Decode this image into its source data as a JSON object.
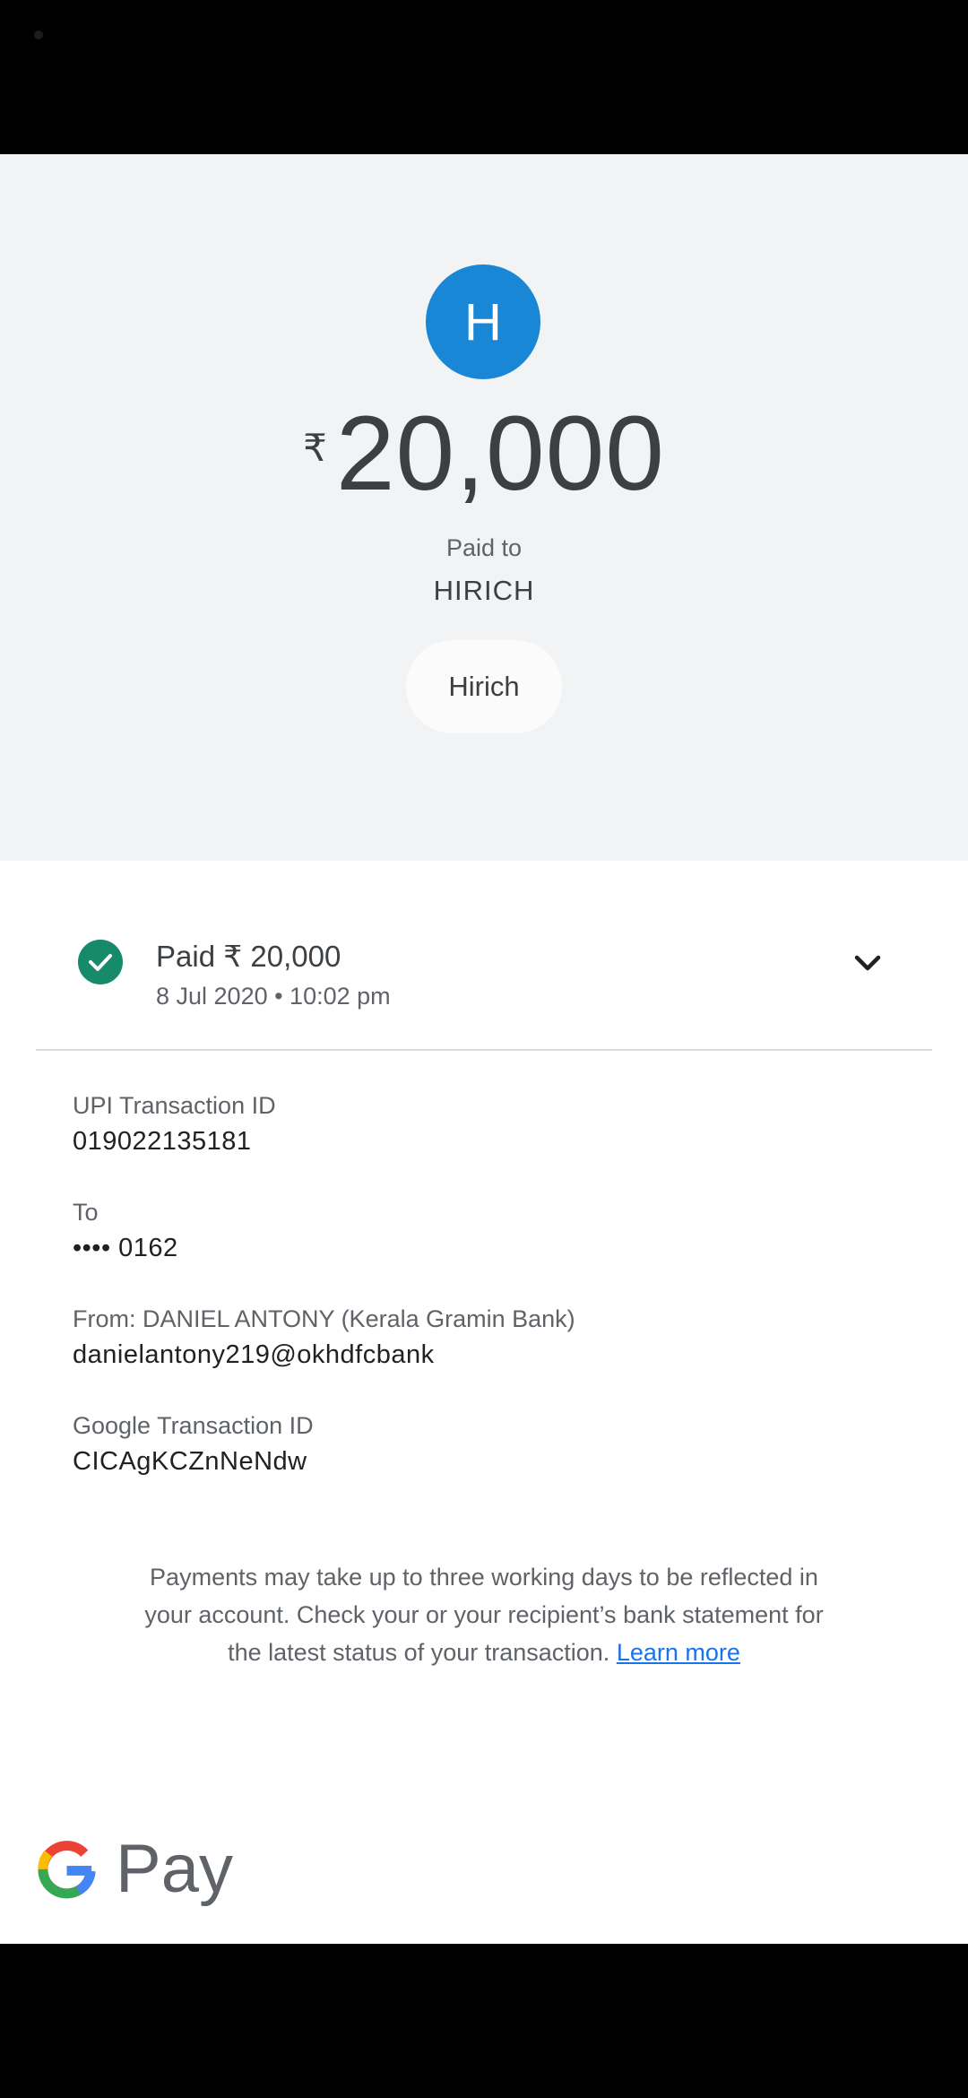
{
  "header": {
    "avatar_initial": "H",
    "currency_symbol": "₹",
    "amount": "20,000",
    "paid_to_label": "Paid to",
    "payee_name": "HIRICH",
    "payee_chip_label": "Hirich"
  },
  "status": {
    "title": "Paid ₹ 20,000",
    "datetime": "8 Jul 2020 • 10:02 pm"
  },
  "details": {
    "upi_label": "UPI Transaction ID",
    "upi_value": "019022135181",
    "to_label": "To",
    "to_value": "•••• 0162",
    "from_label": "From: DANIEL ANTONY (Kerala Gramin Bank)",
    "from_value": "danielantony219@okhdfcbank",
    "google_label": "Google Transaction ID",
    "google_value": "CICAgKCZnNeNdw"
  },
  "footer": {
    "note": "Payments may take up to three working days to be reflected in your account. Check your or your recipient’s bank statement for the latest status of your transaction.",
    "learn_more": "Learn more",
    "logo_text": "Pay"
  },
  "colors": {
    "avatar": "#1a87d6",
    "success": "#188a6c",
    "link": "#1a73e8",
    "header_bg": "#f1f3f4"
  },
  "icons": {
    "status": "check-circle-icon",
    "expand": "chevron-down-icon",
    "logo": "google-g-icon"
  }
}
